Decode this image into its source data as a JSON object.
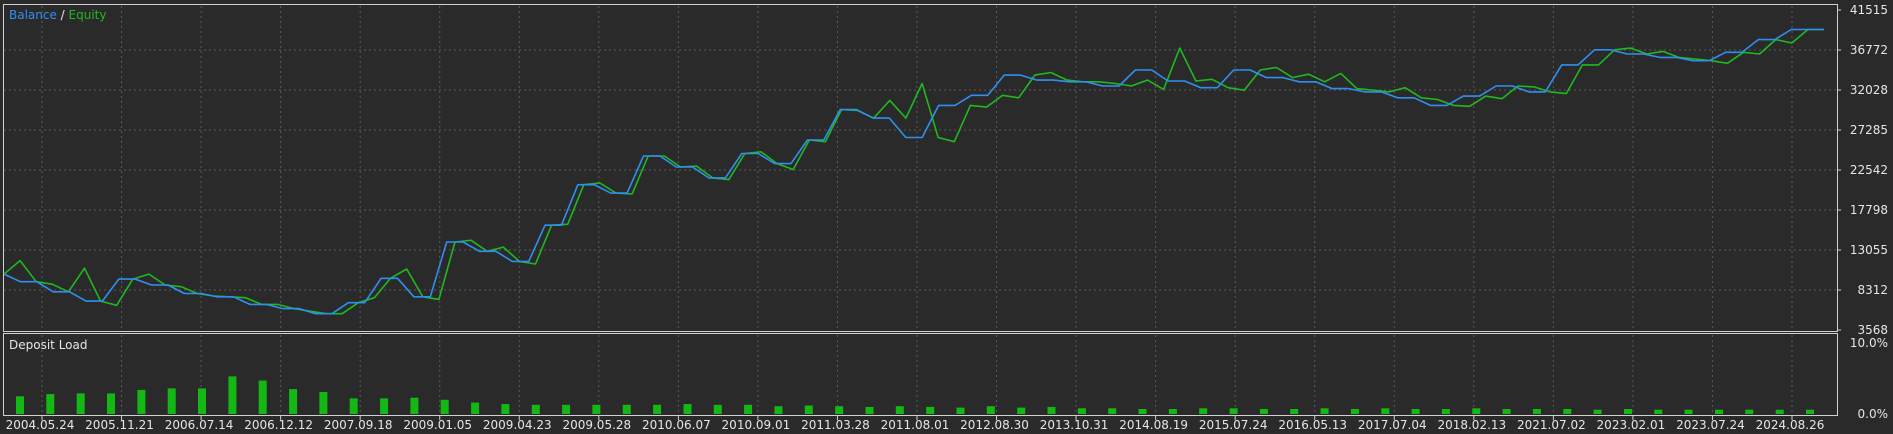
{
  "colors": {
    "background": "#2a2a2a",
    "panel_border": "#d0d0d0",
    "grid": "#5a5a5a",
    "balance": "#2f8ff0",
    "equity": "#1fb81f",
    "bars": "#14b814",
    "text": "#e6e6e6"
  },
  "legend": {
    "balance": "Balance",
    "separator": " / ",
    "equity": "Equity"
  },
  "deposit_label": "Deposit Load",
  "chart_data": [
    {
      "type": "line",
      "grid": true,
      "legend_position": "top-left",
      "ylim": [
        3568,
        41515
      ],
      "y_ticks": [
        3568,
        8312,
        13055,
        17798,
        22542,
        27285,
        32028,
        36772,
        41515
      ],
      "x_tick_labels": [
        "2004.05.24",
        "2005.11.21",
        "2006.07.14",
        "2006.12.12",
        "2007.09.18",
        "2009.01.05",
        "2009.04.23",
        "2009.05.28",
        "2010.06.07",
        "2010.09.01",
        "2011.03.28",
        "2011.08.01",
        "2012.08.30",
        "2013.10.31",
        "2014.08.19",
        "2015.07.24",
        "2016.05.13",
        "2017.07.04",
        "2018.02.13",
        "2021.07.02",
        "2023.02.01",
        "2023.07.24",
        "2024.08.26"
      ],
      "series": [
        {
          "name": "Balance",
          "values": [
            10200,
            9300,
            9300,
            8100,
            8100,
            7000,
            7000,
            9600,
            9600,
            8900,
            8900,
            7900,
            7900,
            7500,
            7500,
            6600,
            6600,
            6100,
            6100,
            5500,
            5500,
            6800,
            6800,
            9700,
            9700,
            7500,
            7500,
            14000,
            14000,
            12900,
            12900,
            11700,
            11700,
            16000,
            16000,
            20800,
            20800,
            19800,
            19800,
            24200,
            24200,
            22900,
            22900,
            21600,
            21600,
            24500,
            24500,
            23300,
            23300,
            26100,
            26100,
            29700,
            29700,
            28700,
            28700,
            26400,
            26400,
            30200,
            30200,
            31400,
            31400,
            33800,
            33800,
            33200,
            33200,
            33000,
            33000,
            32500,
            32500,
            34400,
            34400,
            33100,
            33100,
            32300,
            32300,
            34400,
            34400,
            33500,
            33500,
            33000,
            33000,
            32200,
            32200,
            31800,
            31800,
            31100,
            31100,
            30200,
            30200,
            31300,
            31300,
            32500,
            32500,
            31800,
            31800,
            35000,
            35000,
            36800,
            36800,
            36300,
            36300,
            35900,
            35900,
            35500,
            35500,
            36500,
            36500,
            38000,
            38000,
            39200,
            39200,
            39200
          ]
        },
        {
          "name": "Equity",
          "values": [
            10200,
            11800,
            9300,
            9000,
            8100,
            10900,
            7000,
            6500,
            9600,
            10200,
            8900,
            8700,
            7900,
            7600,
            7500,
            7400,
            6600,
            6600,
            6100,
            5800,
            5500,
            5500,
            6800,
            7400,
            9700,
            10800,
            7500,
            7200,
            14000,
            14200,
            12900,
            13400,
            11700,
            11400,
            16000,
            16100,
            20800,
            21000,
            19800,
            19700,
            24200,
            24200,
            22900,
            23000,
            21600,
            21400,
            24500,
            24700,
            23300,
            22600,
            26100,
            25900,
            29700,
            29600,
            28700,
            30800,
            28700,
            32800,
            26400,
            25900,
            30200,
            30000,
            31400,
            31100,
            33800,
            34100,
            33200,
            33000,
            33000,
            32800,
            32500,
            33200,
            32100,
            37000,
            33100,
            33300,
            32300,
            32000,
            34400,
            34700,
            33500,
            33900,
            33000,
            34000,
            32200,
            32000,
            31800,
            32300,
            31100,
            30900,
            30200,
            30100,
            31300,
            31000,
            32500,
            32400,
            31800,
            31600,
            35000,
            35000,
            36800,
            37000,
            36300,
            36600,
            35900,
            35700,
            35500,
            35200,
            36500,
            36300,
            38000,
            37600,
            39200,
            39200
          ]
        }
      ]
    },
    {
      "type": "bar",
      "title": "Deposit Load",
      "ylim": [
        0,
        10
      ],
      "y_tick_labels": [
        "10.0%",
        "0.0%"
      ],
      "values": [
        2.5,
        2.8,
        2.9,
        2.9,
        3.4,
        3.6,
        3.6,
        5.3,
        4.7,
        3.5,
        3.1,
        2.2,
        2.2,
        2.3,
        2.0,
        1.6,
        1.4,
        1.3,
        1.3,
        1.3,
        1.3,
        1.3,
        1.4,
        1.3,
        1.3,
        1.1,
        1.2,
        1.1,
        1.0,
        1.1,
        1.0,
        0.9,
        1.1,
        0.9,
        1.0,
        0.8,
        0.8,
        0.7,
        0.7,
        0.8,
        0.8,
        0.7,
        0.7,
        0.8,
        0.7,
        0.8,
        0.7,
        0.7,
        0.8,
        0.7,
        0.7,
        0.7,
        0.6,
        0.7,
        0.6,
        0.6,
        0.6,
        0.6,
        0.6,
        0.6
      ]
    }
  ]
}
